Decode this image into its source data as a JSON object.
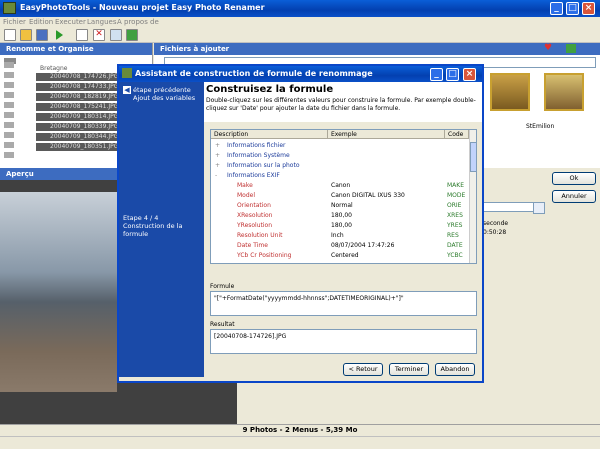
{
  "window": {
    "title": "EasyPhotoTools - Nouveau projet Easy Photo Renamer"
  },
  "menu": [
    "Fichier",
    "Edition",
    "Executer",
    "Langues",
    "A propos de"
  ],
  "left_pane": {
    "title": "Renomme et Organise",
    "folder": "Bretagne",
    "files": [
      "20040708_174726.JPG",
      "20040708_174733.JPG",
      "20040708_182819.JPG",
      "20040708_175241.JPG",
      "20040709_180314.JPG",
      "20040709_180339.JPG",
      "20040709_180344.JPG",
      "20040709_180351.JPG"
    ]
  },
  "right_pane": {
    "title": "Fichiers à ajouter",
    "thumb_label": "StEmilion"
  },
  "preview": {
    "title": "Aperçu"
  },
  "side_buttons": {
    "ok": "Ok",
    "cancel": "Annuler"
  },
  "side_panel": {
    "seconde_label": "seconde",
    "time": "0:50:28"
  },
  "dialog": {
    "title": "Assistant de construction de formule de renommage",
    "side_link_1": "étape précédente",
    "side_link_2": "Ajout des variables",
    "step_label": "Etape 4 / 4",
    "step_desc": "Construction de la formule",
    "heading": "Construisez la formule",
    "instructions": "Double-cliquez sur les différentes valeurs pour construire la formule. Par exemple double-cliquez sur 'Date' pour ajouter la date du fichier dans la formule.",
    "columns": [
      "Description",
      "Exemple",
      "Code"
    ],
    "groups": [
      {
        "label": "Informations fichier",
        "sign": "+"
      },
      {
        "label": "Information Système",
        "sign": "+"
      },
      {
        "label": "Information sur la photo",
        "sign": "+"
      },
      {
        "label": "Informations EXIF",
        "sign": "-"
      }
    ],
    "rows": [
      {
        "desc": "Make",
        "ex": "Canon",
        "code": "MAKE"
      },
      {
        "desc": "Model",
        "ex": "Canon DIGITAL IXUS 330",
        "code": "MODE"
      },
      {
        "desc": "Orientation",
        "ex": "Normal",
        "code": "ORIE"
      },
      {
        "desc": "XResolution",
        "ex": "180,00",
        "code": "XRES"
      },
      {
        "desc": "YResolution",
        "ex": "180,00",
        "code": "YRES"
      },
      {
        "desc": "Resolution Unit",
        "ex": "Inch",
        "code": "RES"
      },
      {
        "desc": "Date Time",
        "ex": "08/07/2004 17:47:26",
        "code": "DATE"
      },
      {
        "desc": "YCb Cr Positioning",
        "ex": "Centered",
        "code": "YCBC"
      }
    ],
    "formula_label": "Formule",
    "formula": "\"[\"+FormatDate(\"yyyymmdd-hhnnss\";DATETIMEORIGINAL)+\"]\"",
    "result_label": "Resultat",
    "result": "[20040708-174726].JPG",
    "buttons": {
      "back": "< Retour",
      "finish": "Terminer",
      "cancel": "Abandon"
    }
  },
  "status": "9 Photos - 2 Menus - 5,39 Mo",
  "colors": {
    "title_blue": "#0a50c8",
    "pane_blue": "#3d6cc0",
    "side_blue": "#1a4aa8",
    "exif_red": "#c03030",
    "code_green": "#2a7a2a"
  }
}
